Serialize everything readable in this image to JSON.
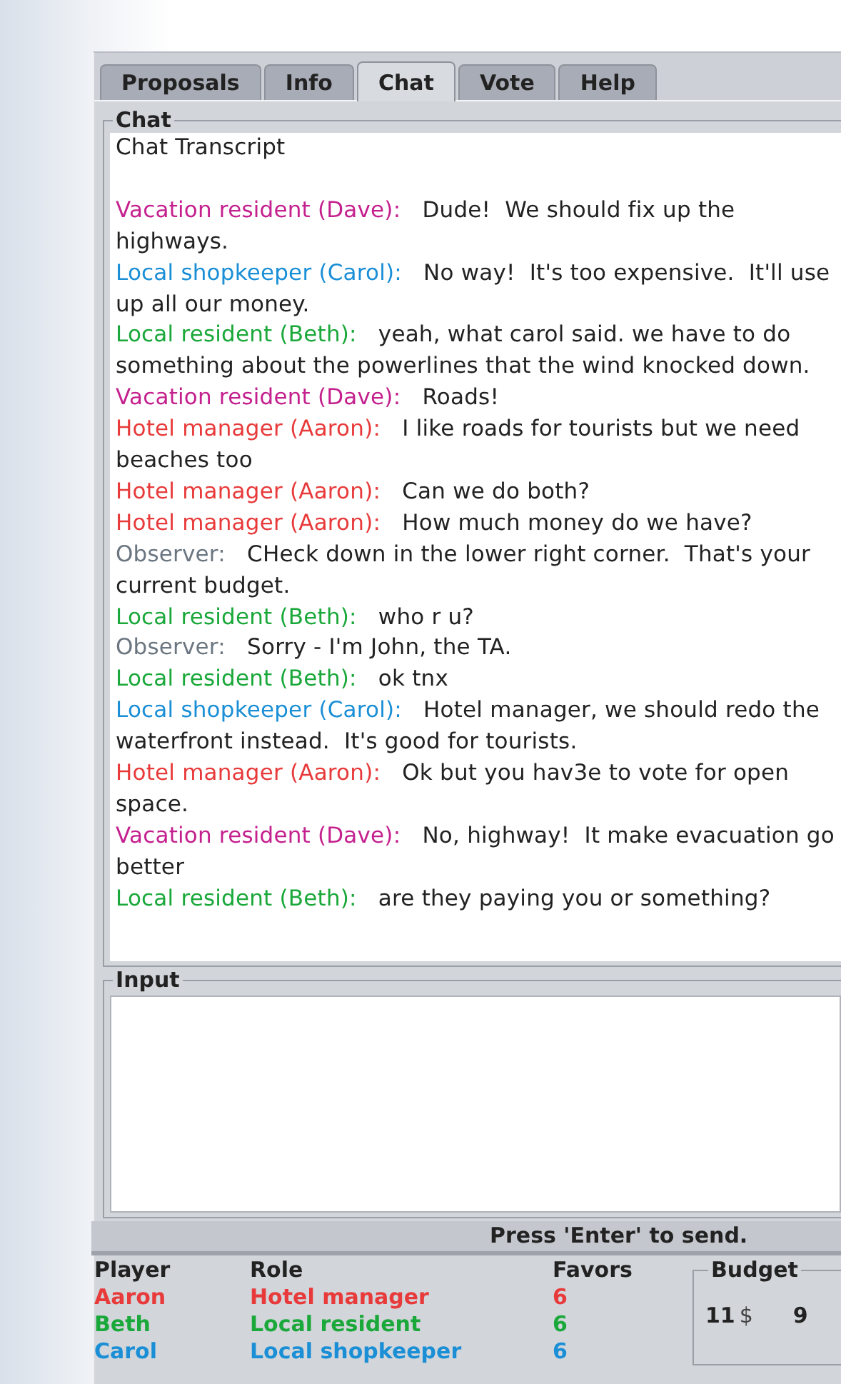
{
  "tabs": [
    {
      "label": "Proposals",
      "selected": false
    },
    {
      "label": "Info",
      "selected": false
    },
    {
      "label": "Chat",
      "selected": true
    },
    {
      "label": "Vote",
      "selected": false
    },
    {
      "label": "Help",
      "selected": false
    }
  ],
  "chat": {
    "title": "Chat",
    "heading": "Chat Transcript",
    "messages": [
      {
        "speaker": "Vacation resident (Dave):",
        "text": "Dude!  We should fix up the highways.",
        "color": "#c4208e"
      },
      {
        "speaker": "Local shopkeeper (Carol):",
        "text": "No way!  It's too expensive.  It'll use up all our money.",
        "color": "#1a8fd6"
      },
      {
        "speaker": "Local resident (Beth):",
        "text": "yeah, what carol said. we have to do something about the powerlines that the wind knocked down.",
        "color": "#1aa83a"
      },
      {
        "speaker": "Vacation resident (Dave):",
        "text": "Roads!",
        "color": "#c4208e"
      },
      {
        "speaker": "Hotel manager (Aaron):",
        "text": "I like roads for tourists but we need beaches too",
        "color": "#e83a3a"
      },
      {
        "speaker": "Hotel manager (Aaron):",
        "text": "Can we do both?",
        "color": "#e83a3a"
      },
      {
        "speaker": "Hotel manager (Aaron):",
        "text": "How much money do we have?",
        "color": "#e83a3a"
      },
      {
        "speaker": "Observer:",
        "text": "CHeck down in the lower right corner.  That's your current budget.",
        "color": "#6b7680"
      },
      {
        "speaker": "Local resident (Beth):",
        "text": "who r u?",
        "color": "#1aa83a"
      },
      {
        "speaker": "Observer:",
        "text": "Sorry - I'm John, the TA.",
        "color": "#6b7680"
      },
      {
        "speaker": "Local resident (Beth):",
        "text": "ok tnx",
        "color": "#1aa83a"
      },
      {
        "speaker": "Local shopkeeper (Carol):",
        "text": "Hotel manager, we should redo the waterfront instead.  It's good for tourists.",
        "color": "#1a8fd6"
      },
      {
        "speaker": "Hotel manager (Aaron):",
        "text": "Ok but you hav3e to vote for open space.",
        "color": "#e83a3a"
      },
      {
        "speaker": "Vacation resident (Dave):",
        "text": "No, highway!  It make evacuation go better",
        "color": "#c4208e"
      },
      {
        "speaker": "Local resident (Beth):",
        "text": "are they paying you or something?",
        "color": "#1aa83a"
      }
    ]
  },
  "input": {
    "title": "Input"
  },
  "hint": "Press 'Enter' to send.",
  "players": {
    "columns": [
      "Player",
      "Role",
      "Favors"
    ],
    "rows": [
      {
        "player": "Aaron",
        "role": "Hotel manager",
        "favors": "6",
        "color": "#e83a3a"
      },
      {
        "player": "Beth",
        "role": "Local resident",
        "favors": "6",
        "color": "#1aa83a"
      },
      {
        "player": "Carol",
        "role": "Local shopkeeper",
        "favors": "6",
        "color": "#1a8fd6"
      }
    ]
  },
  "budget": {
    "title": "Budget",
    "amount": "11",
    "currency": "$",
    "value_2": "9"
  }
}
